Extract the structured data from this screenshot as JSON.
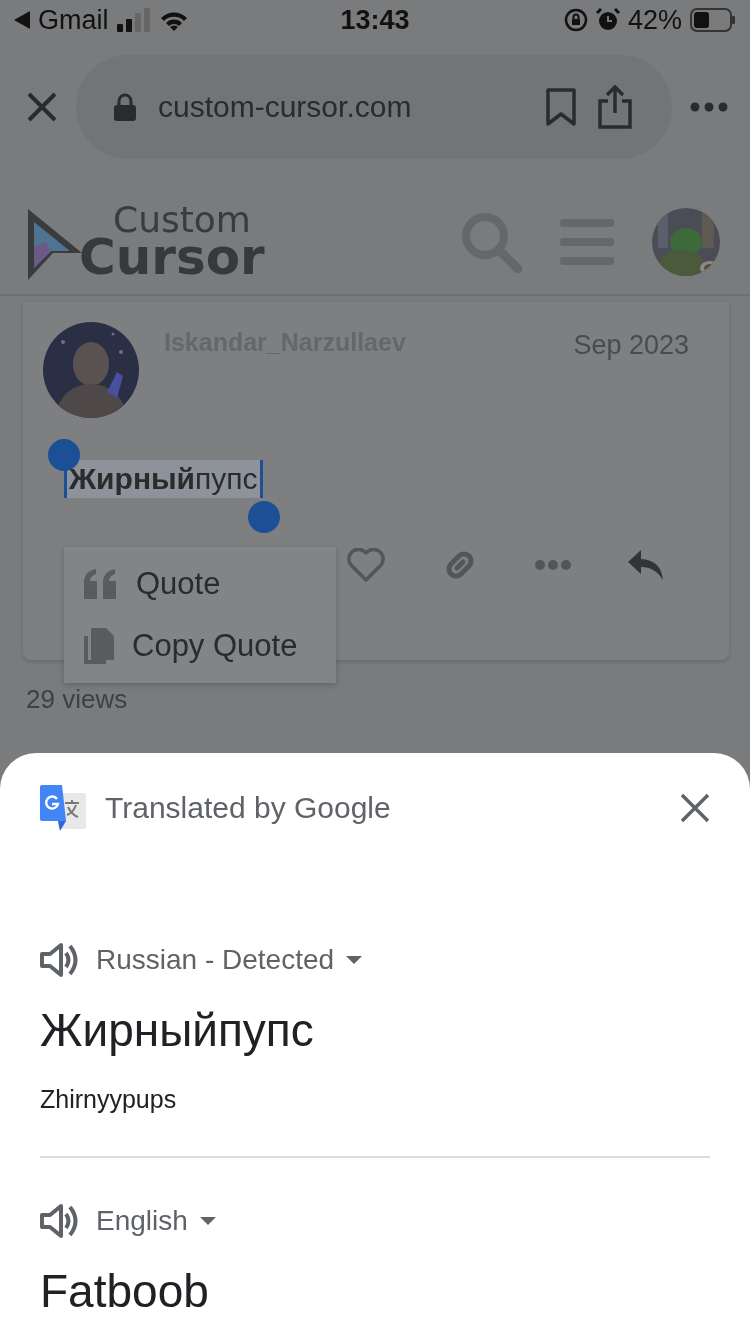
{
  "status_bar": {
    "back_app": "Gmail",
    "time": "13:43",
    "battery": "42%"
  },
  "browser": {
    "url": "custom-cursor.com"
  },
  "site_header": {
    "logo_top": "Custom",
    "logo_bottom": "Cursor"
  },
  "post": {
    "username": "Iskandar_Narzullaev",
    "date": "Sep 2023",
    "text": "**Жирный**пупс",
    "selected": true
  },
  "context_menu": [
    {
      "label": "Quote",
      "kind": "quote"
    },
    {
      "label": "Copy Quote",
      "kind": "copy"
    }
  ],
  "views": "29 views",
  "translate_sheet": {
    "title": "Translated by Google",
    "source": {
      "language": "Russian - Detected",
      "text": "Жирныйпупс",
      "transliteration": "Zhirnyypups"
    },
    "target": {
      "language": "English",
      "text": "Fatboob"
    }
  }
}
